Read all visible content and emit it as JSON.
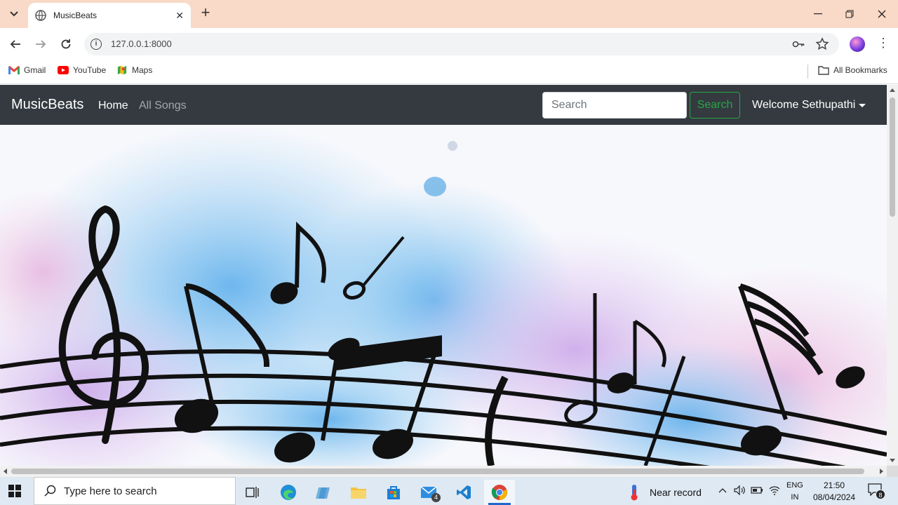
{
  "browser": {
    "tab_title": "MusicBeats",
    "url": "127.0.0.1:8000",
    "bookmarks": [
      {
        "label": "Gmail"
      },
      {
        "label": "YouTube"
      },
      {
        "label": "Maps"
      }
    ],
    "all_bookmarks_label": "All Bookmarks"
  },
  "site": {
    "brand": "MusicBeats",
    "nav_links": [
      {
        "label": "Home",
        "active": true
      },
      {
        "label": "All Songs",
        "active": false
      }
    ],
    "search_placeholder": "Search",
    "search_button": "Search",
    "user_menu_label": "Welcome Sethupathi",
    "colors": {
      "navbar": "#343a40",
      "search_button": "#28a745"
    }
  },
  "taskbar": {
    "search_placeholder": "Type here to search",
    "mail_badge": "4",
    "weather_text": "Near record",
    "language": "ENG",
    "region": "IN",
    "time": "21:50",
    "date": "08/04/2024",
    "notification_count": "8"
  }
}
